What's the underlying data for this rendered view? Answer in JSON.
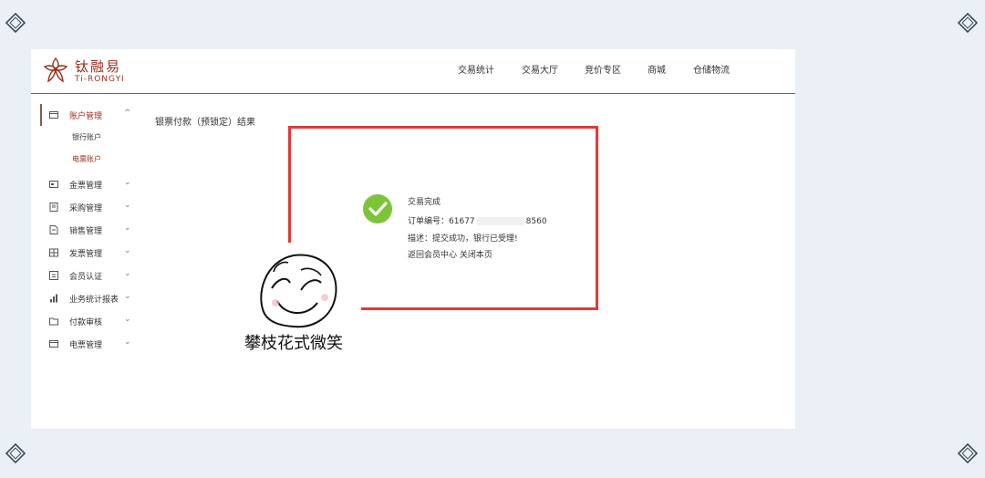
{
  "brand": {
    "name_cn": "钛融易",
    "name_en": "Ti-RONGYI"
  },
  "nav": [
    "交易统计",
    "交易大厅",
    "竞价专区",
    "商城",
    "仓储物流"
  ],
  "sidebar": {
    "items": [
      {
        "label": "账户管理",
        "icon": "account-icon",
        "chevron": "^"
      },
      {
        "label": "金票管理",
        "icon": "ticket-icon",
        "chevron": "⌄"
      },
      {
        "label": "采购管理",
        "icon": "purchase-icon",
        "chevron": "⌄"
      },
      {
        "label": "销售管理",
        "icon": "sales-icon",
        "chevron": "⌄"
      },
      {
        "label": "发票管理",
        "icon": "invoice-icon",
        "chevron": "⌄"
      },
      {
        "label": "会员认证",
        "icon": "member-icon",
        "chevron": "⌄"
      },
      {
        "label": "业务统计报表",
        "icon": "chart-icon",
        "chevron": "⌄"
      },
      {
        "label": "付款审核",
        "icon": "folder-icon",
        "chevron": "⌄"
      },
      {
        "label": "电票管理",
        "icon": "e-ticket-icon",
        "chevron": "⌄"
      }
    ],
    "subitems": [
      "银行账户",
      "电票账户"
    ]
  },
  "page_title": "银票付款（预锁定）结果",
  "result": {
    "status": "交易完成",
    "order_label": "订单编号：",
    "order_prefix": "61677",
    "order_suffix": "8560",
    "desc": "描述：提交成功，银行已受理!",
    "link_member": "返回会员中心",
    "link_close": "关闭本页"
  },
  "sticker_caption": "攀枝花式微笑",
  "colors": {
    "accent": "#9b2f1f",
    "annotation": "#e53935",
    "success": "#7cc43a"
  }
}
